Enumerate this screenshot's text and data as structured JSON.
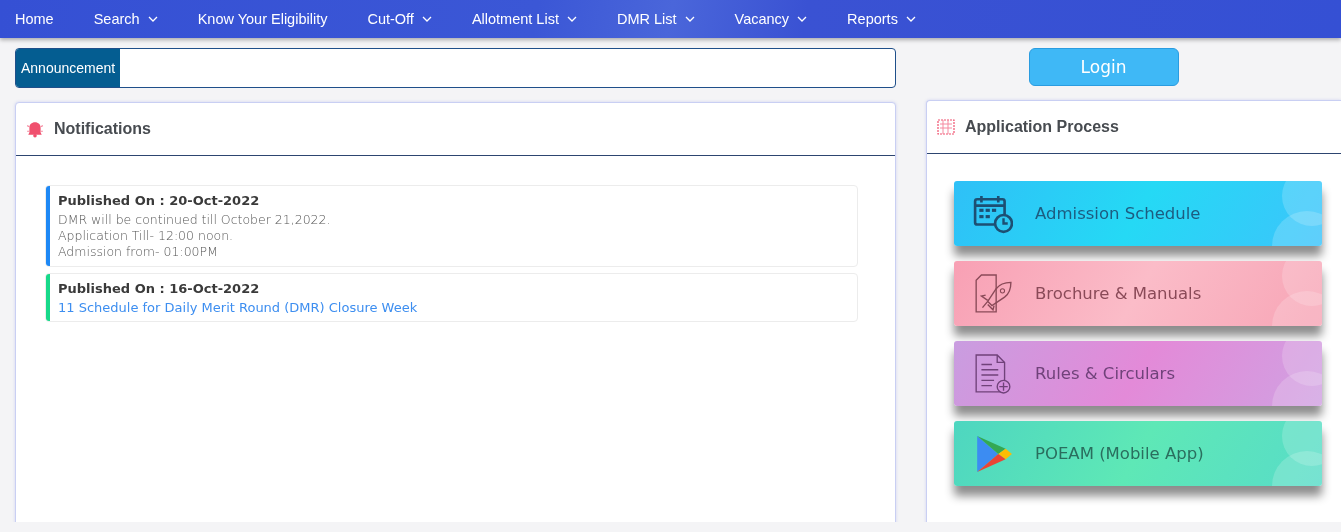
{
  "nav": [
    {
      "label": "Home",
      "dropdown": false
    },
    {
      "label": "Search",
      "dropdown": true
    },
    {
      "label": "Know Your Eligibility",
      "dropdown": false
    },
    {
      "label": "Cut-Off",
      "dropdown": true
    },
    {
      "label": "Allotment List",
      "dropdown": true
    },
    {
      "label": "DMR List",
      "dropdown": true
    },
    {
      "label": "Vacancy",
      "dropdown": true
    },
    {
      "label": "Reports",
      "dropdown": true
    }
  ],
  "announcement": {
    "label": "Announcement"
  },
  "login": {
    "label": "Login"
  },
  "notifications": {
    "title": "Notifications",
    "items": [
      {
        "color": "#1e88f5",
        "heading": "Published On : 20-Oct-2022",
        "kind": "text",
        "lines": [
          "DMR will be continued till October 21,2022.",
          "Application Till- 12:00 noon.",
          "Admission from- 01:00PM"
        ]
      },
      {
        "color": "#17d98a",
        "heading": "Published On : 16-Oct-2022",
        "kind": "link",
        "lines": [
          "11 Schedule for Daily Merit Round (DMR) Closure Week"
        ]
      }
    ]
  },
  "application_process": {
    "title": "Application Process",
    "items": [
      {
        "label": "Admission Schedule",
        "kind": "schedule"
      },
      {
        "label": "Brochure & Manuals",
        "kind": "brochure"
      },
      {
        "label": "Rules & Circulars",
        "kind": "rules"
      },
      {
        "label": "POEAM (Mobile App)",
        "kind": "app"
      }
    ]
  }
}
